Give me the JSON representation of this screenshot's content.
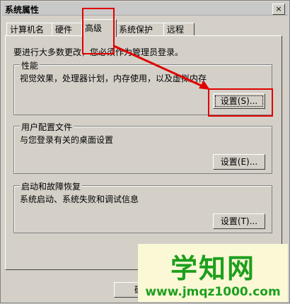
{
  "window": {
    "title": "系统属性",
    "close_label": "×"
  },
  "tabs": [
    {
      "label": "计算机名"
    },
    {
      "label": "硬件"
    },
    {
      "label": "高级"
    },
    {
      "label": "系统保护"
    },
    {
      "label": "远程"
    }
  ],
  "note": "要进行大多数更改，您必须作为管理员登录。",
  "groups": {
    "performance": {
      "title": "性能",
      "desc": "视觉效果，处理器计划，内存使用，以及虚拟内存",
      "button": "设置(S)..."
    },
    "profile": {
      "title": "用户配置文件",
      "desc": "与您登录有关的桌面设置",
      "button": "设置(E)..."
    },
    "startup": {
      "title": "启动和故障恢复",
      "desc": "系统启动、系统失败和调试信息",
      "button": "设置(T)..."
    }
  },
  "bottom": {
    "ok_partial": "确"
  },
  "watermark": {
    "title": "学知网",
    "url": "www.jmqz1000.com"
  },
  "colors": {
    "highlight": "#e00000",
    "watermark": "#1d9f1d",
    "watermark_bg": "#fbf8d6"
  }
}
